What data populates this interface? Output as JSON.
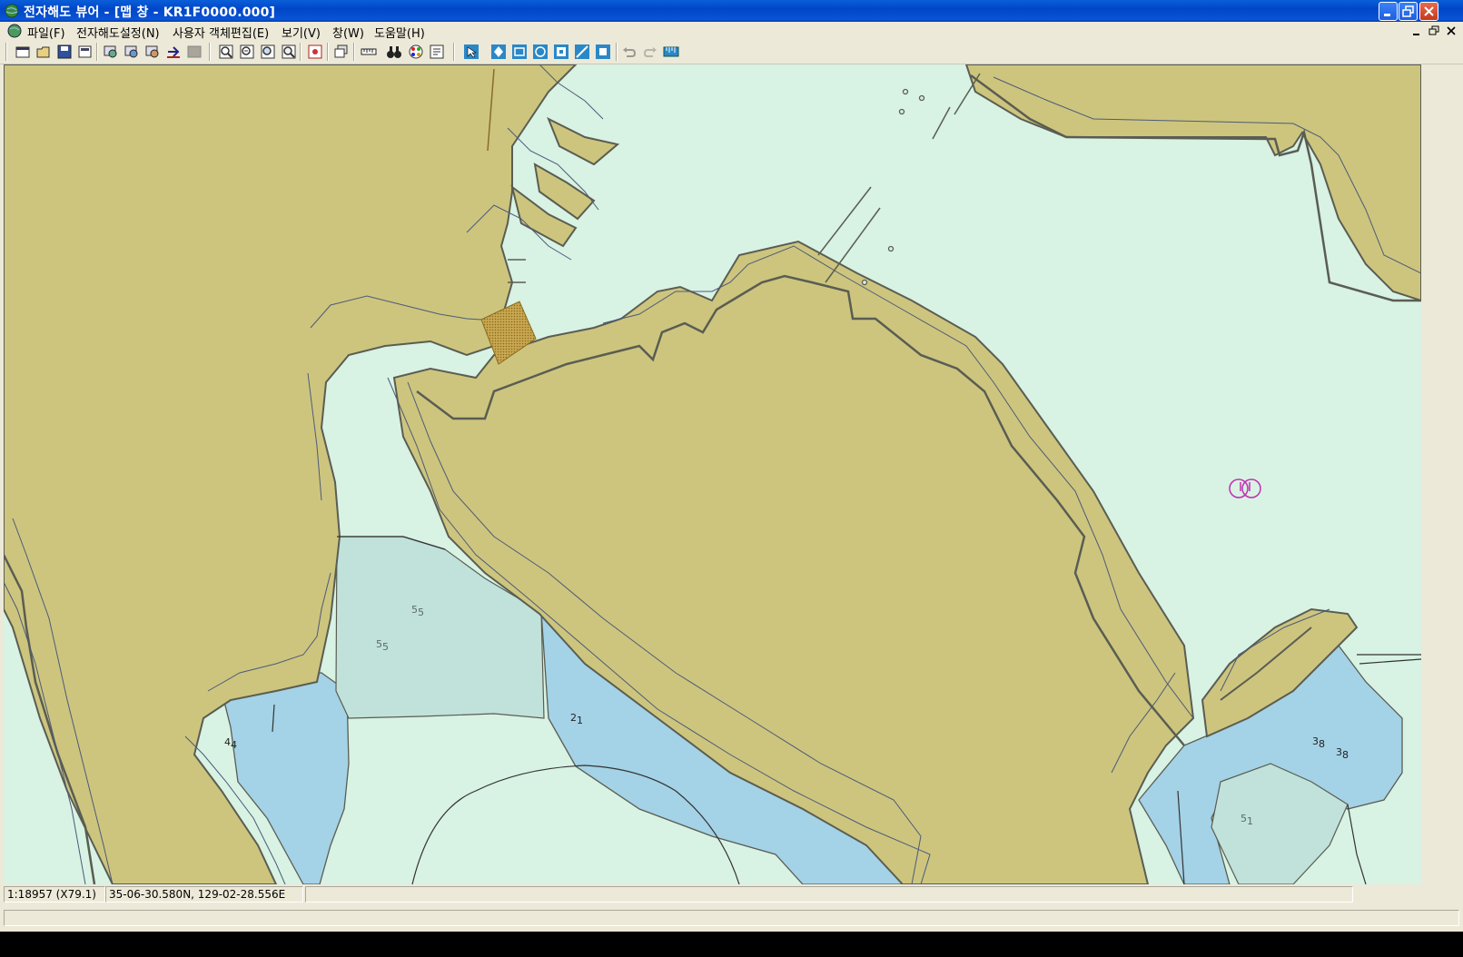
{
  "window": {
    "title": "전자해도 뷰어 - [맵 창 - KR1F0000.000]",
    "controls": [
      "minimize-icon",
      "restore-icon",
      "close-icon"
    ]
  },
  "menubar": {
    "items": [
      {
        "label": "파일(F)"
      },
      {
        "label": "전자해도설정(N)"
      },
      {
        "label": "사용자 객체편집(E)"
      },
      {
        "label": "보기(V)"
      },
      {
        "label": "창(W)"
      },
      {
        "label": "도움말(H)"
      }
    ],
    "mdi_controls": [
      "minimize-icon",
      "restore-icon",
      "close-icon"
    ]
  },
  "toolbar": {
    "buttons": [
      "new-chart-icon",
      "open-folder-icon",
      "save-icon",
      "save-as-icon",
      "layer-1-icon",
      "layer-2-icon",
      "layer-3-icon",
      "import-icon",
      "grey-block-icon",
      "zoom-in-icon",
      "zoom-out-icon",
      "zoom-window-icon",
      "zoom-fit-icon",
      "chart-info-icon",
      "windows-icon",
      "ruler-icon",
      "binoculars-icon",
      "palette-icon",
      "object-info-icon",
      "select-arrow-icon",
      "pan-icon",
      "rect-icon",
      "circle-icon",
      "text-icon",
      "line-icon",
      "fill-icon",
      "undo-icon",
      "redo-icon",
      "measure-icon"
    ]
  },
  "map": {
    "colors": {
      "water_shallow_light": "#d8f2e4",
      "land": "#cdc57e",
      "depth_mid": "#c0e2da",
      "depth_deep": "#a4d2e6",
      "coastline": "#5a5d52",
      "contour": "#4d5a78",
      "symbol": "#c030b0"
    },
    "depth_labels": [
      {
        "main": "5",
        "sub": "5"
      },
      {
        "main": "5",
        "sub": "5"
      },
      {
        "main": "2",
        "sub": "1"
      },
      {
        "main": "4",
        "sub": "4"
      },
      {
        "main": "3",
        "sub": "8"
      },
      {
        "main": "3",
        "sub": "8"
      },
      {
        "main": "5",
        "sub": "1"
      }
    ],
    "symbols": [
      "mooring-symbol-icon"
    ]
  },
  "status": {
    "scale": "1:18957 (X79.1)",
    "coordinates": "35-06-30.580N, 129-02-28.556E",
    "message": ""
  }
}
